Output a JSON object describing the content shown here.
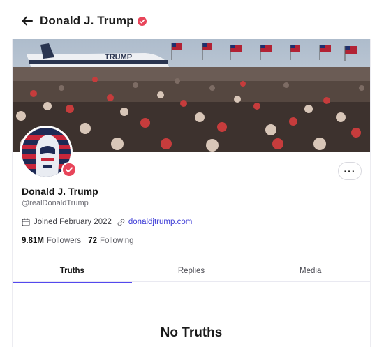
{
  "header": {
    "back_icon": "arrow-left-icon",
    "title": "Donald J. Trump",
    "verified_icon": "verified-badge-icon"
  },
  "profile": {
    "banner_image": "rally-crowd-with-flags-and-airplane",
    "avatar_image": "stylized-portrait-with-american-flag",
    "display_name": "Donald J. Trump",
    "handle": "@realDonaldTrump",
    "joined_icon": "calendar-icon",
    "joined": "Joined February 2022",
    "website_icon": "link-icon",
    "website": "donaldjtrump.com",
    "more_label": "···",
    "followers_count": "9.81M",
    "followers_label": "Followers",
    "following_count": "72",
    "following_label": "Following"
  },
  "tabs": [
    {
      "label": "Truths",
      "active": true
    },
    {
      "label": "Replies",
      "active": false
    },
    {
      "label": "Media",
      "active": false
    }
  ],
  "empty_state": {
    "title": "No Truths"
  },
  "colors": {
    "accent": "#5448ee",
    "verified": "#e8455a",
    "link": "#3b3ad6"
  }
}
